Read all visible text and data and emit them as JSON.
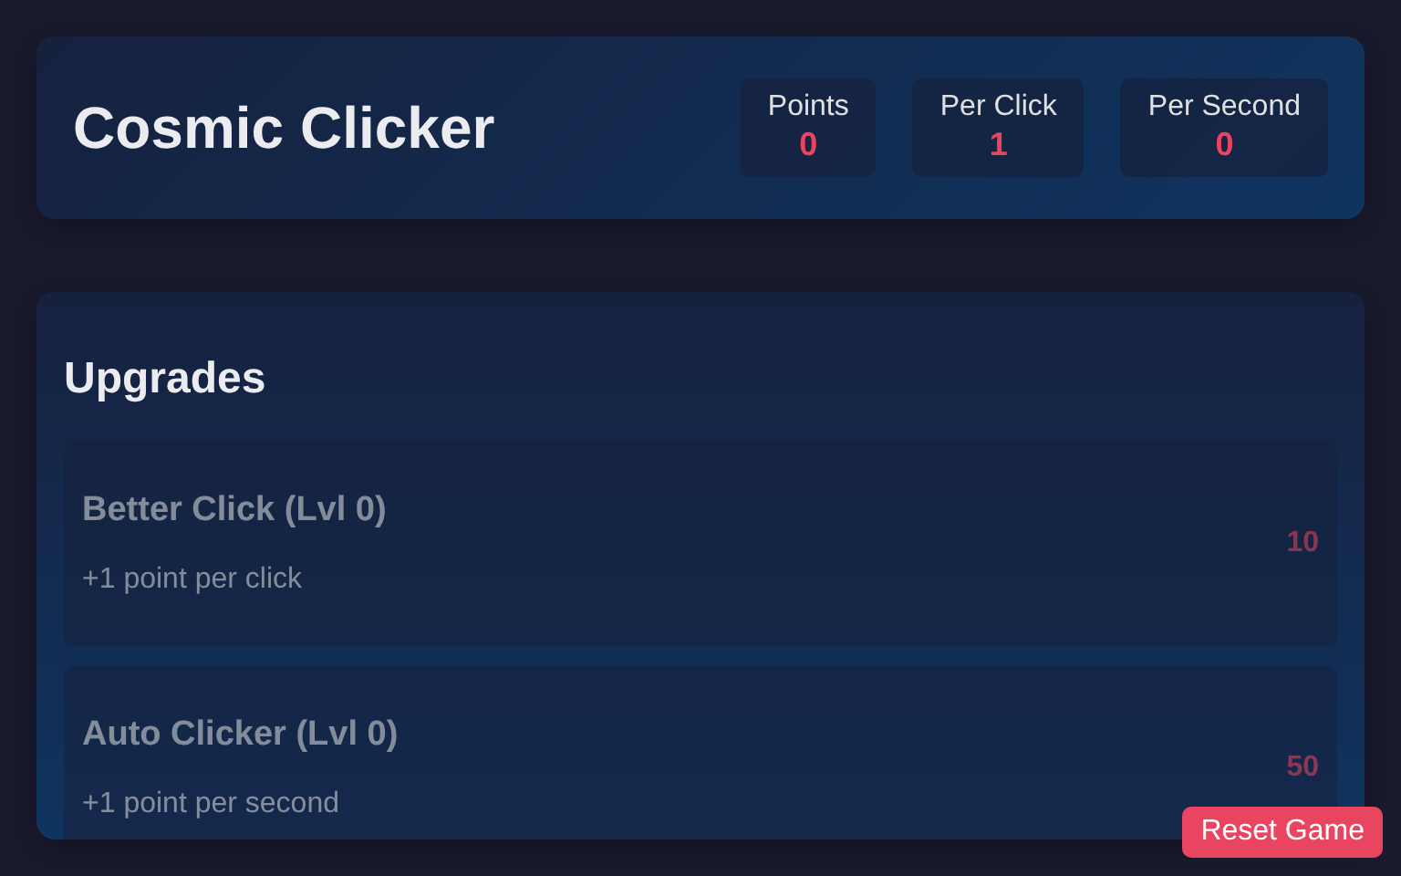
{
  "header": {
    "title": "Cosmic Clicker",
    "stats": [
      {
        "label": "Points",
        "value": "0"
      },
      {
        "label": "Per Click",
        "value": "1"
      },
      {
        "label": "Per Second",
        "value": "0"
      }
    ]
  },
  "upgrades": {
    "title": "Upgrades",
    "items": [
      {
        "name": "Better Click (Lvl 0)",
        "description": "+1 point per click",
        "cost": "10",
        "disabled": true
      },
      {
        "name": "Auto Clicker (Lvl 0)",
        "description": "+1 point per second",
        "cost": "50",
        "disabled": true
      }
    ]
  },
  "reset_button": "Reset Game"
}
